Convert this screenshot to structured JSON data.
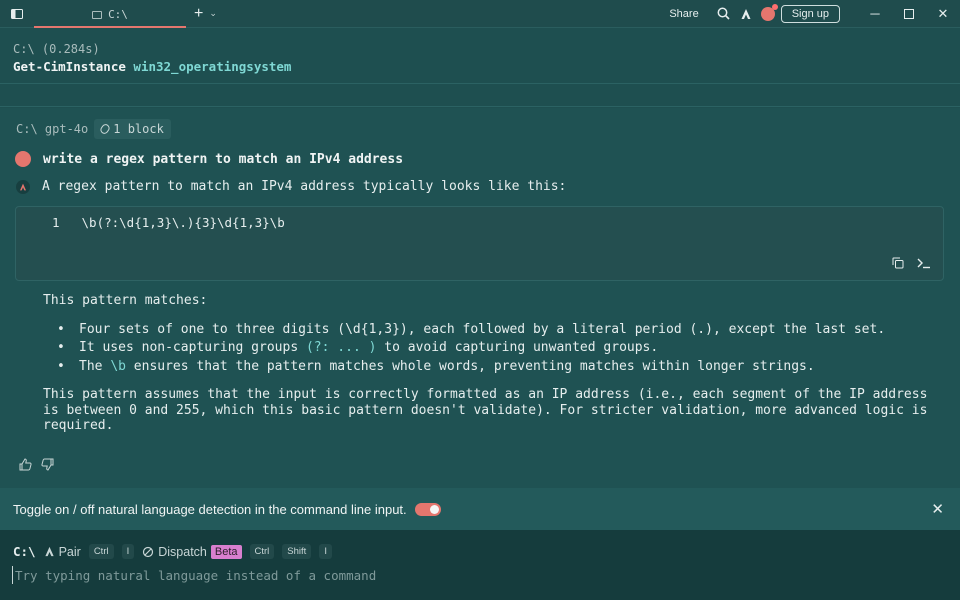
{
  "titlebar": {
    "tab_label": "C:\\",
    "share_label": "Share",
    "signup_label": "Sign up"
  },
  "prev_block": {
    "prompt": "C:\\ (0.284s)",
    "command": "Get-CimInstance",
    "argument": "win32_operatingsystem"
  },
  "ai_block": {
    "header_path": "C:\\ gpt-4o",
    "context_chip": "1 block",
    "user_message": "write a regex pattern to match an IPv4 address",
    "bot_intro": "A regex pattern to match an IPv4 address typically looks like this:",
    "code": {
      "line_number": "1",
      "code_text": "\\b(?:\\d{1,3}\\.){3}\\d{1,3}\\b"
    },
    "answer": {
      "lead": "This pattern matches:",
      "bullets": [
        {
          "text": "Four sets of one to three digits (\\d{1,3}), each followed by a literal period (.), except the last set."
        },
        {
          "pre": "It uses non-capturing groups ",
          "code": "(?: ... )",
          "post": " to avoid capturing unwanted groups."
        },
        {
          "pre": "The ",
          "code": "\\b",
          "post": " ensures that the pattern matches whole words, preventing matches within longer strings."
        }
      ],
      "closing": "This pattern assumes that the input is correctly formatted as an IP address (i.e., each segment of the IP address is between 0 and 255, which this basic pattern doesn't validate). For stricter validation, more advanced logic is required."
    }
  },
  "toast": {
    "text": "Toggle on / off natural language detection in the command line input."
  },
  "input": {
    "cwd": "C:\\",
    "pair_label": "Pair",
    "pair_key1": "Ctrl",
    "pair_key2": "I",
    "dispatch_label": "Dispatch",
    "beta_badge": "Beta",
    "dispatch_key1": "Ctrl",
    "dispatch_key2": "Shift",
    "dispatch_key3": "I",
    "placeholder": "Try typing natural language instead of a command"
  },
  "colors": {
    "accent": "#e4766e",
    "background": "#1e4f50",
    "inline_code": "#7fd8d4",
    "beta": "#d87fcf"
  }
}
